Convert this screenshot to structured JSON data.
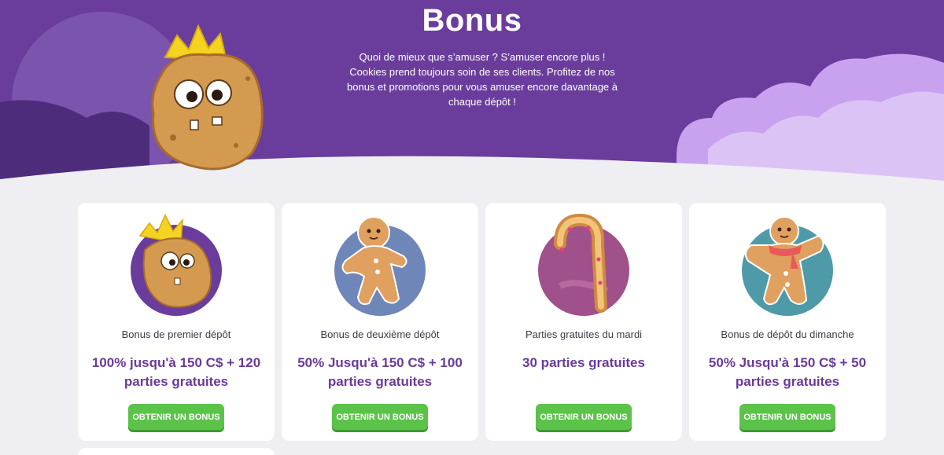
{
  "hero": {
    "title": "Bonus",
    "description": "Quoi de mieux que s’amuser ? S’amuser encore plus ! Cookies prend toujours soin de ses clients. Profitez de nos bonus et promotions pour vous amuser encore davantage à chaque dépôt !",
    "mascot_icon": "crowned-cookie-mascot"
  },
  "colors": {
    "hero_purple": "#6a3d9c",
    "offer_text": "#6a3a9a",
    "button_green": "#5cc34a",
    "page_bg": "#eeeef3"
  },
  "cards": [
    {
      "icon": "crowned-cookie-icon",
      "title": "Bonus de premier dépôt",
      "offer": "100% jusqu'à 150 C$ + 120 parties gratuites",
      "button": "OBTENIR UN BONUS"
    },
    {
      "icon": "gingerbread-man-icon",
      "title": "Bonus de deuxième dépôt",
      "offer": "50% Jusqu'à 150 C$ + 100 parties gratuites",
      "button": "OBTENIR UN BONUS"
    },
    {
      "icon": "candy-cane-icon",
      "title": "Parties gratuites du mardi",
      "offer": "30 parties gratuites",
      "button": "OBTENIR UN BONUS"
    },
    {
      "icon": "gingerbread-scarf-icon",
      "title": "Bonus de dépôt du dimanche",
      "offer": "50% Jusqu'à 150 C$ + 50 parties gratuites",
      "button": "OBTENIR UN BONUS"
    }
  ]
}
